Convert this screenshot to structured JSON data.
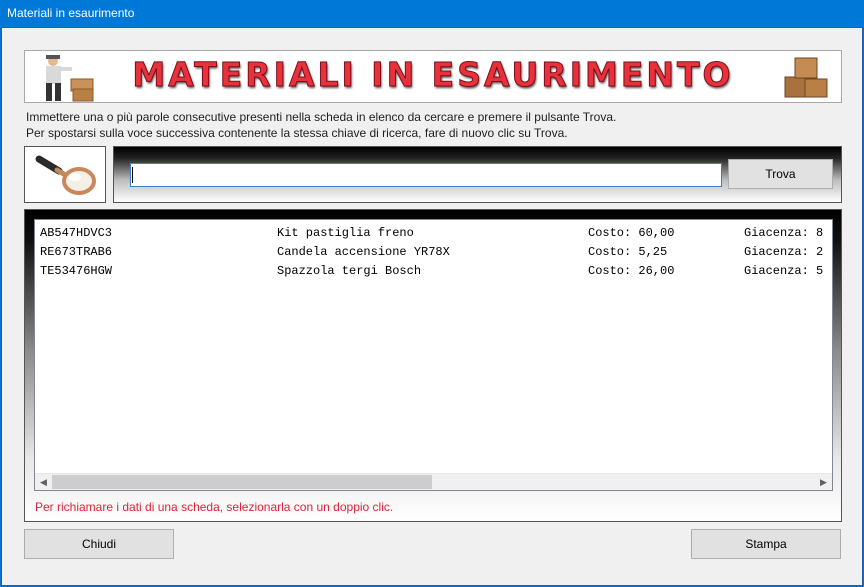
{
  "window": {
    "title": "Materiali in esaurimento"
  },
  "banner": {
    "title": "MATERIALI IN ESAURIMENTO"
  },
  "instructions": {
    "line1": "Immettere una o più parole consecutive presenti nella scheda in elenco da cercare e premere il pulsante Trova.",
    "line2": "Per spostarsi sulla voce successiva contenente la stessa chiave di ricerca, fare di nuovo clic su Trova."
  },
  "search": {
    "value": "",
    "button_label": "Trova"
  },
  "list": {
    "rows": [
      {
        "code": "AB547HDVC3",
        "description": "Kit pastiglia freno",
        "cost": "Costo: 60,00",
        "stock": "Giacenza: 8"
      },
      {
        "code": "RE673TRAB6",
        "description": "Candela accensione YR78X",
        "cost": "Costo: 5,25",
        "stock": "Giacenza: 2"
      },
      {
        "code": "TE53476HGW",
        "description": "Spazzola tergi Bosch",
        "cost": "Costo: 26,00",
        "stock": "Giacenza: 5"
      }
    ],
    "hint": "Per richiamare i dati di una scheda, selezionarla con un doppio clic."
  },
  "buttons": {
    "close_label": "Chiudi",
    "print_label": "Stampa"
  },
  "icons": {
    "banner_left": "worker-with-boxes-icon",
    "banner_right": "cardboard-boxes-icon",
    "search": "magnifying-glass-icon"
  },
  "colors": {
    "titlebar": "#0078d7",
    "banner_text": "#e8313b",
    "hint_text": "#e0223a"
  }
}
